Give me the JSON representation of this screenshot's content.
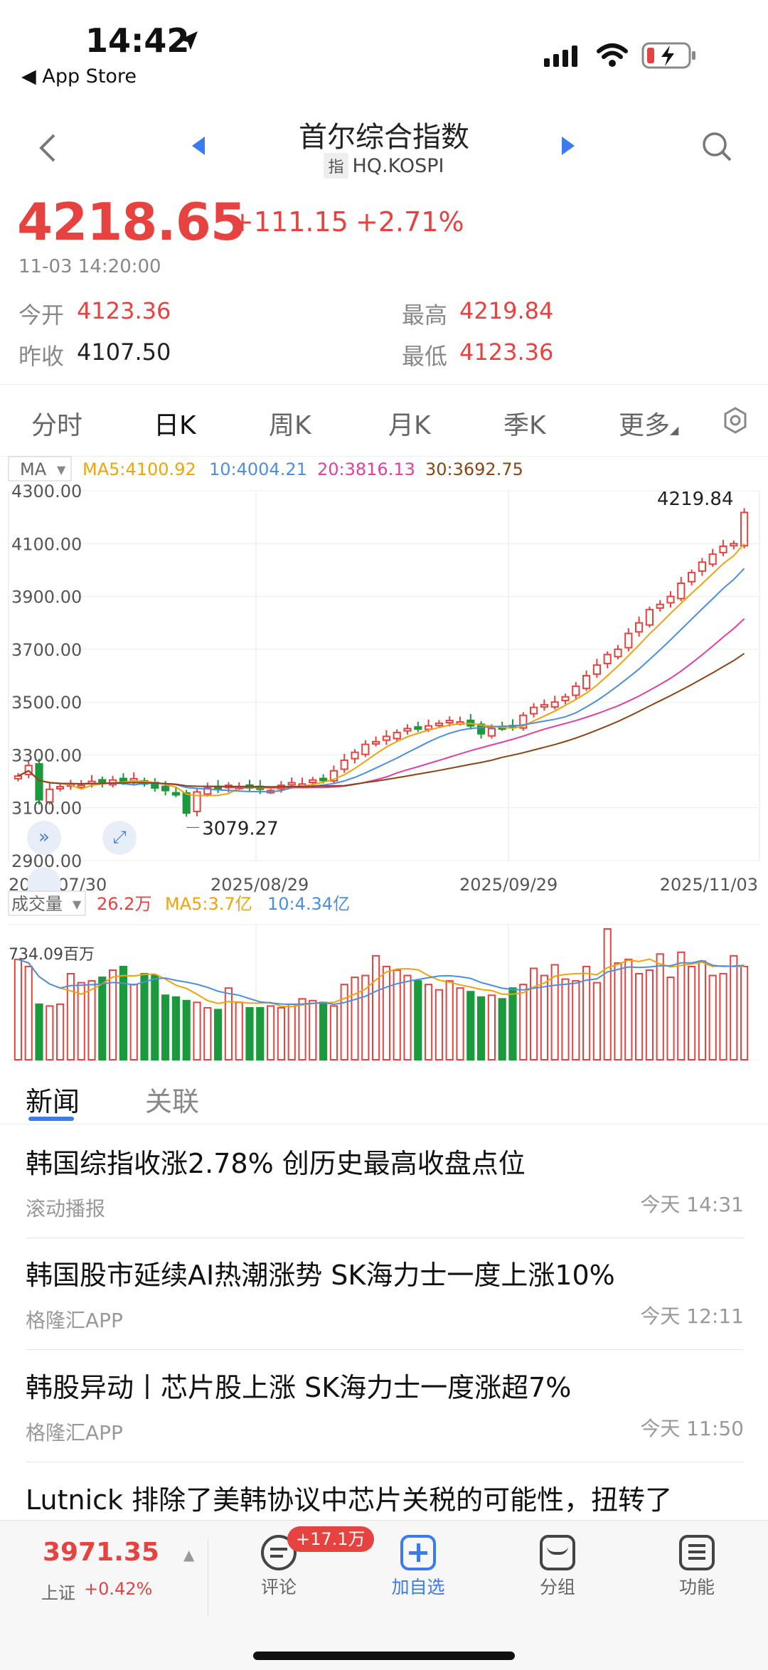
{
  "status_bar": {
    "time": "14:42",
    "back_app": "◀ App Store"
  },
  "nav": {
    "title": "首尔综合指数",
    "code_tag": "指",
    "code": "HQ.KOSPI"
  },
  "quote": {
    "price": "4218.65",
    "change": "+111.15",
    "change_pct": "+2.71%",
    "time": "11-03 14:20:00",
    "open_label": "今开",
    "open": "4123.36",
    "high_label": "最高",
    "high": "4219.84",
    "prev_label": "昨收",
    "prev": "4107.50",
    "low_label": "最低",
    "low": "4123.36"
  },
  "tabs": [
    "分时",
    "日K",
    "周K",
    "月K",
    "季K",
    "更多"
  ],
  "ma_legend": {
    "selector": "MA",
    "ma5": "MA5:4100.92",
    "ma10": "10:4004.21",
    "ma20": "20:3816.13",
    "ma30": "30:3692.75"
  },
  "colors": {
    "up": "#e64340",
    "down": "#1a9a3c",
    "ma5": "#f0a30a",
    "ma10": "#4a8fe0",
    "ma20": "#e040a0",
    "ma30": "#8b4513",
    "accent": "#3a7bf0"
  },
  "chart_data": {
    "type": "candlestick",
    "y_ticks": [
      "4300.00",
      "4100.00",
      "3900.00",
      "3700.00",
      "3500.00",
      "3300.00",
      "3100.00",
      "2900.00"
    ],
    "ylim": [
      2900,
      4300
    ],
    "x_ticks": [
      "2025/07/30",
      "2025/08/29",
      "2025/09/29",
      "2025/11/03"
    ],
    "max_label": "4219.84",
    "min_label": "3079.27",
    "closes": [
      3220,
      3260,
      3130,
      3170,
      3180,
      3190,
      3185,
      3200,
      3195,
      3205,
      3200,
      3210,
      3190,
      3175,
      3165,
      3150,
      3080,
      3160,
      3175,
      3170,
      3185,
      3180,
      3175,
      3170,
      3165,
      3185,
      3195,
      3190,
      3205,
      3210,
      3240,
      3280,
      3310,
      3340,
      3350,
      3370,
      3385,
      3400,
      3405,
      3410,
      3420,
      3430,
      3425,
      3410,
      3380,
      3400,
      3405,
      3410,
      3450,
      3480,
      3490,
      3500,
      3520,
      3560,
      3600,
      3640,
      3680,
      3700,
      3760,
      3800,
      3850,
      3870,
      3900,
      3950,
      3990,
      4030,
      4060,
      4090,
      4100,
      4218
    ],
    "volume": {
      "label": "成交量",
      "value": "26.2万",
      "ma5": "MA5:3.7亿",
      "ma10": "10:4.34亿",
      "max_label": "734.09百万",
      "values": [
        560,
        520,
        310,
        300,
        310,
        480,
        430,
        440,
        460,
        500,
        520,
        420,
        480,
        470,
        360,
        350,
        330,
        320,
        290,
        280,
        400,
        320,
        290,
        290,
        300,
        290,
        310,
        340,
        330,
        320,
        300,
        420,
        460,
        470,
        580,
        520,
        500,
        470,
        440,
        420,
        390,
        440,
        400,
        380,
        350,
        360,
        340,
        400,
        420,
        510,
        470,
        530,
        450,
        440,
        520,
        430,
        730,
        540,
        560,
        480,
        500,
        590,
        460,
        600,
        520,
        550,
        470,
        480,
        580,
        520
      ]
    }
  },
  "news_tabs": [
    "新闻",
    "关联"
  ],
  "news": [
    {
      "title": "韩国综指收涨2.78% 创历史最高收盘点位",
      "source": "滚动播报",
      "time": "今天 14:31"
    },
    {
      "title": "韩国股市延续AI热潮涨势 SK海力士一度上涨10%",
      "source": "格隆汇APP",
      "time": "今天 12:11"
    },
    {
      "title": "韩股异动丨芯片股上涨 SK海力士一度涨超7%",
      "source": "格隆汇APP",
      "time": "今天 11:50"
    },
    {
      "title": "Lutnick 排除了美韩协议中芯片关税的可能性，扭转了",
      "source": "",
      "time": ""
    }
  ],
  "bottom_bar": {
    "index_value": "3971.35",
    "index_name": "上证",
    "index_pct": "+0.42%",
    "comment_badge": "+17.1万",
    "comment": "评论",
    "add": "加自选",
    "group": "分组",
    "func": "功能"
  }
}
